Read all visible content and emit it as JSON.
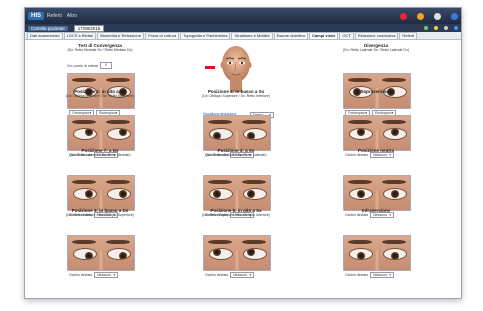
{
  "app": {
    "logo": "HIS",
    "menu": [
      "Referti",
      "Altro"
    ]
  },
  "toolbar": {
    "left_label": "Cartella paziente",
    "select_value": "17/08/2015"
  },
  "tabs": [
    "Dati anamnestici",
    "LOCS e Blefari",
    "Biometria e Refrazione",
    "Prova di Lettura",
    "Topografia e Pachimetria",
    "Strabismo e Motilità",
    "Esame obiettivo",
    "Campi visivi",
    "OCT",
    "Relazione conclusiva",
    "Referti"
  ],
  "active_tab_index": 7,
  "cells": [
    {
      "title": "Test di Convergenza",
      "sub": "(Dx: Retto Mediale Sx / Retto Mediale Dx)",
      "ctrl": ""
    },
    {
      "title": "Divergenza",
      "sub": "(Dx: Retto Laterale Sx / Retto Laterale Dx)",
      "ctrl": ""
    },
    {
      "title": "Posizione 1: in alto a Dx",
      "sub": "(Dx: Obliquo Inferiore / Sx: Retto Superiore)",
      "ctrl": "Occhio deviato"
    },
    {
      "title": "Posizione 4: in basso a Sx",
      "sub": "(Dx: Obliquo Superiore / Sx: Retto Inferiore)",
      "ctrl": "Occhio deviato"
    },
    {
      "title": "Sopraversione",
      "sub": "",
      "ctrl": "Occhio deviato"
    },
    {
      "title": "Posizione 7: a Dx",
      "sub": "(Dx: Retto Laterale / Sx: Retto Mediale)",
      "ctrl": "Occhio deviato"
    },
    {
      "title": "Posizione 3: a Sx",
      "sub": "(Dx: Retto Mediale / Sx: Retto Laterale)",
      "ctrl": "Occhio deviato"
    },
    {
      "title": "Posizione neutra",
      "sub": "",
      "ctrl": "Occhio deviato"
    },
    {
      "title": "Posizione 3: in basso a Dx",
      "sub": "(Dx: Retto Inferiore / Sx: Obliquo Superiore)",
      "ctrl": "Occhio deviato"
    },
    {
      "title": "Posizione 6: in alto a Sx",
      "sub": "(Dx: Retto Superiore / Sx: Obliquo Inferiore)",
      "ctrl": "Occhio deviato"
    },
    {
      "title": "Infraversione",
      "sub": "",
      "ctrl": "Occhio deviato"
    }
  ],
  "dropdown_default": "Nessuno",
  "center_dropdown": "Destro",
  "center_link": "Visualizza deviazione",
  "stepper_label": "Cm: punto di rottura",
  "stepper_value": "0",
  "conv_options": {
    "left": "Ortotropico",
    "right": "Esotropico"
  },
  "colors": {
    "titlebar": "#1f2a40",
    "accent": "#d01818"
  }
}
